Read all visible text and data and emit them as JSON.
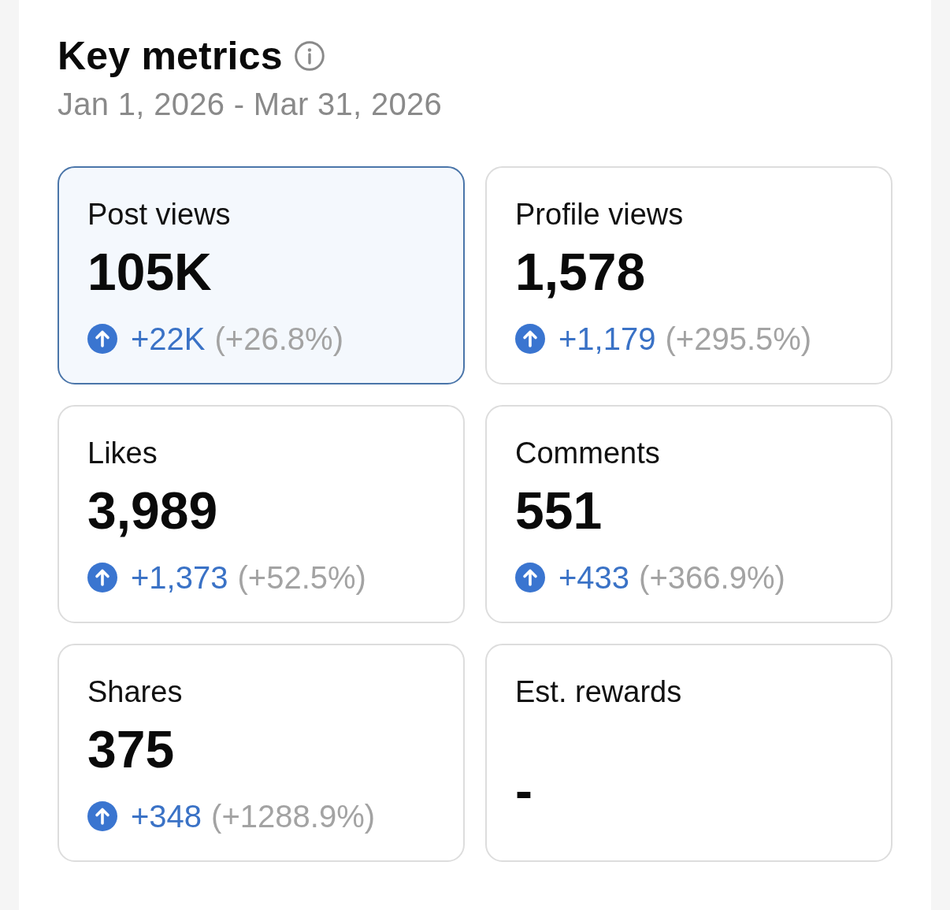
{
  "panel": {
    "title": "Key metrics",
    "date_range": "Jan 1, 2026 - Mar 31, 2026"
  },
  "metrics": [
    {
      "label": "Post views",
      "value": "105K",
      "selected": true,
      "delta": {
        "kind": "up",
        "change": "+22K",
        "percent": "(+26.8%)"
      }
    },
    {
      "label": "Profile views",
      "value": "1,578",
      "selected": false,
      "delta": {
        "kind": "up",
        "change": "+1,179",
        "percent": "(+295.5%)"
      }
    },
    {
      "label": "Likes",
      "value": "3,989",
      "selected": false,
      "delta": {
        "kind": "up",
        "change": "+1,373",
        "percent": "(+52.5%)"
      }
    },
    {
      "label": "Comments",
      "value": "551",
      "selected": false,
      "delta": {
        "kind": "up",
        "change": "+433",
        "percent": "(+366.9%)"
      }
    },
    {
      "label": "Shares",
      "value": "375",
      "selected": false,
      "delta": {
        "kind": "up",
        "change": "+348",
        "percent": "(+1288.9%)"
      }
    },
    {
      "label": "Est. rewards",
      "value": "-",
      "selected": false
    }
  ]
}
